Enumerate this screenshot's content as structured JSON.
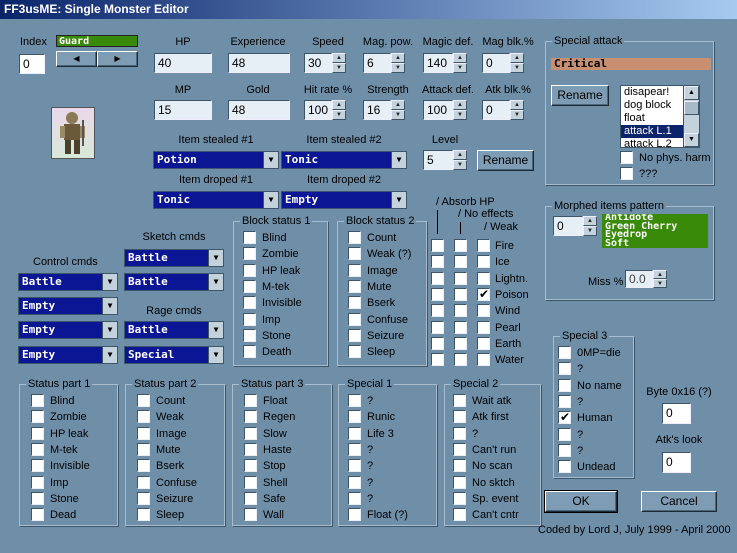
{
  "window": {
    "title": "FF3usME: Single Monster Editor"
  },
  "index": {
    "label": "Index",
    "value": "0",
    "name": "Guard"
  },
  "stats": {
    "hp": {
      "label": "HP",
      "value": "40"
    },
    "experience": {
      "label": "Experience",
      "value": "48"
    },
    "speed": {
      "label": "Speed",
      "value": "30"
    },
    "mag_pow": {
      "label": "Mag. pow.",
      "value": "6"
    },
    "magic_def": {
      "label": "Magic def.",
      "value": "140"
    },
    "mag_blk": {
      "label": "Mag blk.%",
      "value": "0"
    },
    "mp": {
      "label": "MP",
      "value": "15"
    },
    "gold": {
      "label": "Gold",
      "value": "48"
    },
    "hit_rate": {
      "label": "Hit rate %",
      "value": "100"
    },
    "strength": {
      "label": "Strength",
      "value": "16"
    },
    "attack_def": {
      "label": "Attack def.",
      "value": "100"
    },
    "atk_blk": {
      "label": "Atk blk.%",
      "value": "0"
    },
    "level": {
      "label": "Level",
      "value": "5"
    }
  },
  "items": {
    "stolen1": {
      "label": "Item stealed #1",
      "value": "Potion"
    },
    "stolen2": {
      "label": "Item stealed #2",
      "value": "Tonic"
    },
    "dropped1": {
      "label": "Item droped #1",
      "value": "Tonic"
    },
    "dropped2": {
      "label": "Item droped #2",
      "value": "Empty"
    },
    "rename_label": "Rename"
  },
  "control": {
    "label": "Control cmds",
    "values": [
      "Battle",
      "Empty",
      "Empty",
      "Empty"
    ]
  },
  "sketch": {
    "label": "Sketch cmds",
    "values": [
      "Battle",
      "Battle"
    ]
  },
  "rage": {
    "label": "Rage cmds",
    "values": [
      "Battle",
      "Special"
    ]
  },
  "block1": {
    "title": "Block status 1",
    "items": [
      {
        "label": "Blind",
        "checked": false
      },
      {
        "label": "Zombie",
        "checked": false
      },
      {
        "label": "HP leak",
        "checked": false
      },
      {
        "label": "M-tek",
        "checked": false
      },
      {
        "label": "Invisible",
        "checked": false
      },
      {
        "label": "Imp",
        "checked": false
      },
      {
        "label": "Stone",
        "checked": false
      },
      {
        "label": "Death",
        "checked": false
      }
    ]
  },
  "block2": {
    "title": "Block status 2",
    "items": [
      {
        "label": "Count",
        "checked": false
      },
      {
        "label": "Weak (?)",
        "checked": false
      },
      {
        "label": "Image",
        "checked": false
      },
      {
        "label": "Mute",
        "checked": false
      },
      {
        "label": "Bserk",
        "checked": false
      },
      {
        "label": "Confuse",
        "checked": false
      },
      {
        "label": "Seizure",
        "checked": false
      },
      {
        "label": "Sleep",
        "checked": false
      }
    ]
  },
  "elements": {
    "header_absorb": "/ Absorb HP",
    "header_noeffect": "/ No effects",
    "header_weak": "/ Weak",
    "items": [
      {
        "label": "Fire",
        "absorb": false,
        "noeffect": false,
        "weak": false
      },
      {
        "label": "Ice",
        "absorb": false,
        "noeffect": false,
        "weak": false
      },
      {
        "label": "Lightn.",
        "absorb": false,
        "noeffect": false,
        "weak": false
      },
      {
        "label": "Poison",
        "absorb": false,
        "noeffect": false,
        "weak": true
      },
      {
        "label": "Wind",
        "absorb": false,
        "noeffect": false,
        "weak": false
      },
      {
        "label": "Pearl",
        "absorb": false,
        "noeffect": false,
        "weak": false
      },
      {
        "label": "Earth",
        "absorb": false,
        "noeffect": false,
        "weak": false
      },
      {
        "label": "Water",
        "absorb": false,
        "noeffect": false,
        "weak": false
      }
    ]
  },
  "status1": {
    "title": "Status part 1",
    "items": [
      {
        "label": "Blind",
        "checked": false
      },
      {
        "label": "Zombie",
        "checked": false
      },
      {
        "label": "HP leak",
        "checked": false
      },
      {
        "label": "M-tek",
        "checked": false
      },
      {
        "label": "Invisible",
        "checked": false
      },
      {
        "label": "Imp",
        "checked": false
      },
      {
        "label": "Stone",
        "checked": false
      },
      {
        "label": "Dead",
        "checked": false
      }
    ]
  },
  "status2": {
    "title": "Status part 2",
    "items": [
      {
        "label": "Count",
        "checked": false
      },
      {
        "label": "Weak",
        "checked": false
      },
      {
        "label": "Image",
        "checked": false
      },
      {
        "label": "Mute",
        "checked": false
      },
      {
        "label": "Bserk",
        "checked": false
      },
      {
        "label": "Confuse",
        "checked": false
      },
      {
        "label": "Seizure",
        "checked": false
      },
      {
        "label": "Sleep",
        "checked": false
      }
    ]
  },
  "status3": {
    "title": "Status part 3",
    "items": [
      {
        "label": "Float",
        "checked": false
      },
      {
        "label": "Regen",
        "checked": false
      },
      {
        "label": "Slow",
        "checked": false
      },
      {
        "label": "Haste",
        "checked": false
      },
      {
        "label": "Stop",
        "checked": false
      },
      {
        "label": "Shell",
        "checked": false
      },
      {
        "label": "Safe",
        "checked": false
      },
      {
        "label": "Wall",
        "checked": false
      }
    ]
  },
  "special1": {
    "title": "Special 1",
    "items": [
      {
        "label": "?",
        "checked": false
      },
      {
        "label": "Runic",
        "checked": false
      },
      {
        "label": "Life 3",
        "checked": false
      },
      {
        "label": "?",
        "checked": false
      },
      {
        "label": "?",
        "checked": false
      },
      {
        "label": "?",
        "checked": false
      },
      {
        "label": "?",
        "checked": false
      },
      {
        "label": "Float (?)",
        "checked": false
      }
    ]
  },
  "special2": {
    "title": "Special 2",
    "items": [
      {
        "label": "Wait atk",
        "checked": false
      },
      {
        "label": "Atk first",
        "checked": false
      },
      {
        "label": "?",
        "checked": false
      },
      {
        "label": "Can't run",
        "checked": false
      },
      {
        "label": "No scan",
        "checked": false
      },
      {
        "label": "No sktch",
        "checked": false
      },
      {
        "label": "Sp. event",
        "checked": false
      },
      {
        "label": "Can't cntr",
        "checked": false
      }
    ]
  },
  "special3": {
    "title": "Special 3",
    "items": [
      {
        "label": "0MP=die",
        "checked": false
      },
      {
        "label": "?",
        "checked": false
      },
      {
        "label": "No name",
        "checked": false
      },
      {
        "label": "?",
        "checked": false
      },
      {
        "label": "Human",
        "checked": true
      },
      {
        "label": "?",
        "checked": false
      },
      {
        "label": "?",
        "checked": false
      },
      {
        "label": "Undead",
        "checked": false
      }
    ]
  },
  "special_attack": {
    "title": "Special attack",
    "name": "Critical",
    "rename_label": "Rename",
    "list": [
      "disapear!",
      "dog block",
      "float",
      "attack L.1",
      "attack L.2"
    ],
    "selected": "attack L.1",
    "no_phys_harm": "No phys. harm",
    "unknown": "???"
  },
  "morphed": {
    "title": "Morphed items pattern",
    "value": "0",
    "items": [
      "Antidote",
      "Green Cherry",
      "Eyedrop",
      "Soft"
    ],
    "miss_label": "Miss %",
    "miss_value": "0.0"
  },
  "byte": {
    "label": "Byte 0x16 (?)",
    "value": "0"
  },
  "look": {
    "label": "Atk's look",
    "value": "0"
  },
  "buttons": {
    "ok": "OK",
    "cancel": "Cancel"
  },
  "credit": "Coded by Lord J, July 1999 - April 2000",
  "colors": {
    "background": "#6f8fa8",
    "dropdown": "#0b1694",
    "item_green": "#3a8a0a",
    "attack_orange": "#c89070"
  }
}
